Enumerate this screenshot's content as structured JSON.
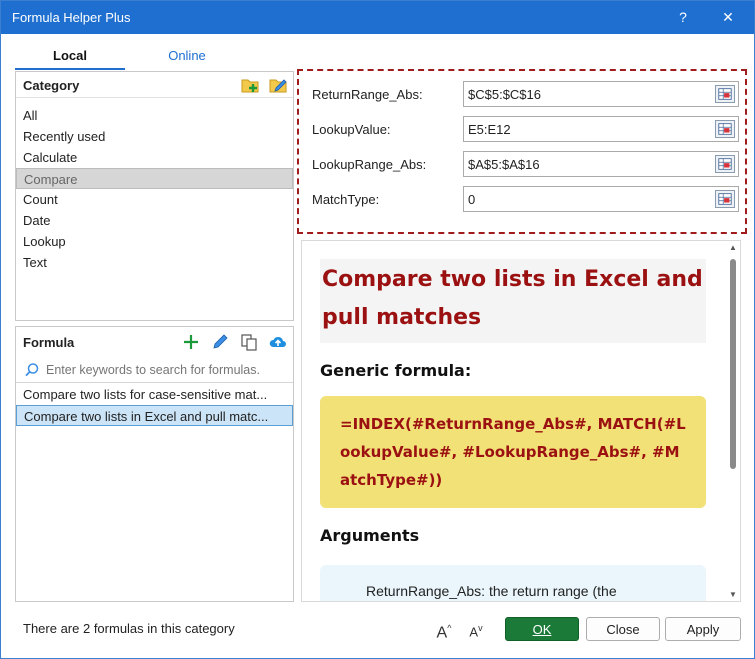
{
  "window": {
    "title": "Formula Helper Plus",
    "help_label": "?",
    "close_label": "✕"
  },
  "tabs": [
    {
      "label": "Local"
    },
    {
      "label": "Online"
    }
  ],
  "category": {
    "title": "Category",
    "items": [
      "All",
      "Recently used",
      "Calculate",
      "Compare",
      "Count",
      "Date",
      "Lookup",
      "Text"
    ],
    "selected": "Compare"
  },
  "formula": {
    "title": "Formula",
    "search_placeholder": "Enter keywords to search for formulas.",
    "items": [
      "Compare two lists for case-sensitive mat...",
      "Compare two lists in Excel and pull matc..."
    ]
  },
  "arguments": [
    {
      "label": "ReturnRange_Abs:",
      "value": "$C$5:$C$16"
    },
    {
      "label": "LookupValue:",
      "value": "E5:E12"
    },
    {
      "label": "LookupRange_Abs:",
      "value": "$A$5:$A$16"
    },
    {
      "label": "MatchType:",
      "value": "0"
    }
  ],
  "preview": {
    "title": "Compare two lists in Excel and pull matches",
    "generic_heading": "Generic formula:",
    "formula_text": "=INDEX(#ReturnRange_Abs#, MATCH(#LookupValue#, #LookupRange_Abs#, #MatchType#))",
    "arguments_heading": "Arguments",
    "arg_first_line": "ReturnRange_Abs: the return range (the"
  },
  "footer": {
    "status": "There are 2 formulas in this category",
    "font_up": "A",
    "font_down": "A",
    "ok_label": "OK",
    "close_label": "Close",
    "apply_label": "Apply"
  },
  "colors": {
    "accent": "#1e6fd0",
    "ok_green": "#1b7a38",
    "title_red": "#9b1111",
    "formula_bg": "#f2e177"
  }
}
